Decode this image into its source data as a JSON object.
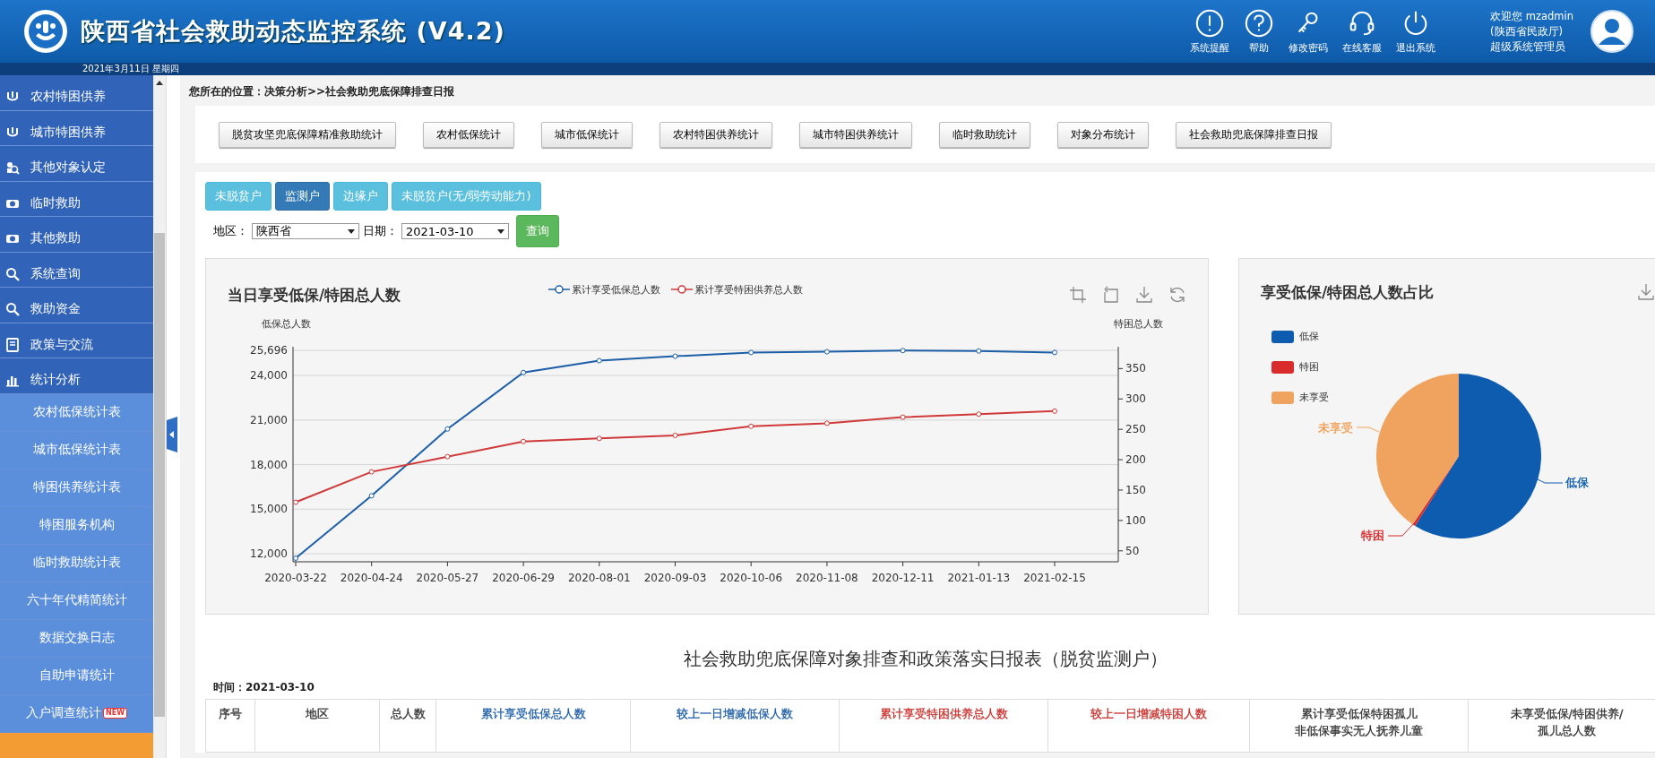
{
  "header": {
    "title": "陕西省社会救助动态监控系统 (V4.2)",
    "date": "2021年3月11日 星期四",
    "actions": [
      {
        "label": "系统提醒"
      },
      {
        "label": "帮助"
      },
      {
        "label": "修改密码"
      },
      {
        "label": "在线客服"
      },
      {
        "label": "退出系统"
      }
    ],
    "user": {
      "greeting": "欢迎您 mzadmin",
      "org": "(陕西省民政厅)",
      "role": "超级系统管理员"
    }
  },
  "sidebar": {
    "items": [
      {
        "label": "农村特困供养",
        "kind": "main"
      },
      {
        "label": "城市特困供养",
        "kind": "main"
      },
      {
        "label": "其他对象认定",
        "kind": "main"
      },
      {
        "label": "临时救助",
        "kind": "main"
      },
      {
        "label": "其他救助",
        "kind": "main"
      },
      {
        "label": "系统查询",
        "kind": "main"
      },
      {
        "label": "救助资金",
        "kind": "main"
      },
      {
        "label": "政策与交流",
        "kind": "main"
      },
      {
        "label": "统计分析",
        "kind": "main"
      },
      {
        "label": "农村低保统计表",
        "kind": "sub"
      },
      {
        "label": "城市低保统计表",
        "kind": "sub"
      },
      {
        "label": "特困供养统计表",
        "kind": "sub"
      },
      {
        "label": "特困服务机构",
        "kind": "sub"
      },
      {
        "label": "临时救助统计表",
        "kind": "sub"
      },
      {
        "label": "六十年代精简统计",
        "kind": "sub"
      },
      {
        "label": "数据交换日志",
        "kind": "sub"
      },
      {
        "label": "自助申请统计",
        "kind": "sub"
      },
      {
        "label": "入户调查统计",
        "kind": "sub",
        "badge": "NEW"
      }
    ]
  },
  "breadcrumb": "您所在的位置：决策分析>>社会救助兜底保障排查日报",
  "nav_buttons": [
    "脱贫攻坚兜底保障精准救助统计",
    "农村低保统计",
    "城市低保统计",
    "农村特困供养统计",
    "城市特困供养统计",
    "临时救助统计",
    "对象分布统计",
    "社会救助兜底保障排查日报"
  ],
  "tabs": [
    {
      "label": "未脱贫户",
      "selected": false
    },
    {
      "label": "监测户",
      "selected": true
    },
    {
      "label": "边缘户",
      "selected": false
    },
    {
      "label": "未脱贫户(无/弱劳动能力)",
      "selected": false
    }
  ],
  "filters": {
    "region_label": "地区：",
    "region": "陕西省",
    "date_label": "日期：",
    "date": "2021-03-10",
    "query": "查询"
  },
  "line_card": {
    "chart_data": {
      "type": "line",
      "title": "当日享受低保/特困总人数",
      "ylabel": "低保总人数",
      "y2label": "特困总人数",
      "x": [
        "2020-03-22",
        "2020-04-24",
        "2020-05-27",
        "2020-06-29",
        "2020-08-01",
        "2020-09-03",
        "2020-10-06",
        "2020-11-08",
        "2020-12-11",
        "2021-01-13",
        "2021-02-15"
      ],
      "grid": true,
      "ylim": [
        11457,
        25696
      ],
      "yticks": [
        {
          "value": 12000,
          "label": "12,000"
        },
        {
          "value": 15000,
          "label": "15,000"
        },
        {
          "value": 18000,
          "label": "18,000"
        },
        {
          "value": 21000,
          "label": "21,000"
        },
        {
          "value": 24000,
          "label": "24,000"
        },
        {
          "value": 25696,
          "label": "25,696"
        }
      ],
      "y2lim": [
        32,
        380
      ],
      "y2ticks": [
        50,
        100,
        150,
        200,
        250,
        300,
        350
      ],
      "series": [
        {
          "name": "累计享受低保总人数",
          "color": "#1c5fa8",
          "marker": "circle",
          "values": [
            11700,
            15900,
            20400,
            24200,
            25000,
            25300,
            25550,
            25600,
            25680,
            25650,
            25550
          ]
        },
        {
          "name": "累计享受特困供养总人数",
          "color": "#d0393a",
          "marker": "circle",
          "axis": "y2",
          "values": [
            130,
            180,
            205,
            230,
            235,
            240,
            255,
            260,
            270,
            275,
            280
          ]
        }
      ]
    }
  },
  "pie_card": {
    "title": "享受低保/特困总人数占比",
    "legend": [
      {
        "label": "低保",
        "color": "#0d5cb0"
      },
      {
        "label": "特困",
        "color": "#d92b2b"
      },
      {
        "label": "未享受",
        "color": "#f0a35e"
      }
    ],
    "slice_labels": [
      {
        "label": "低保",
        "color": "#0d5cb0"
      },
      {
        "label": "特困",
        "color": "#d92b2b"
      },
      {
        "label": "未享受",
        "color": "#f0a35e"
      }
    ]
  },
  "report": {
    "title": "社会救助兜底保障对象排查和政策落实日报表（脱贫监测户）",
    "time_label": "时间：",
    "time": "2021-03-10",
    "columns": [
      {
        "lines": [
          "序号"
        ],
        "color": "#333333"
      },
      {
        "lines": [
          "地区"
        ],
        "color": "#333333"
      },
      {
        "lines": [
          "总人数"
        ],
        "color": "#333333"
      },
      {
        "lines": [
          "累计享受低保总人数"
        ],
        "color": "#1f5fa8"
      },
      {
        "lines": [
          "较上一日增减低保人数"
        ],
        "color": "#1f5fa8"
      },
      {
        "lines": [
          "累计享受特困供养总人数"
        ],
        "color": "#c9302c"
      },
      {
        "lines": [
          "较上一日增减特困人数"
        ],
        "color": "#c9302c"
      },
      {
        "lines": [
          "累计享受低保特困孤儿",
          "非低保事实无人抚养儿童"
        ],
        "color": "#333333"
      },
      {
        "lines": [
          "未享受低保/特困供养/",
          "孤儿总人数"
        ],
        "color": "#333333"
      }
    ]
  }
}
